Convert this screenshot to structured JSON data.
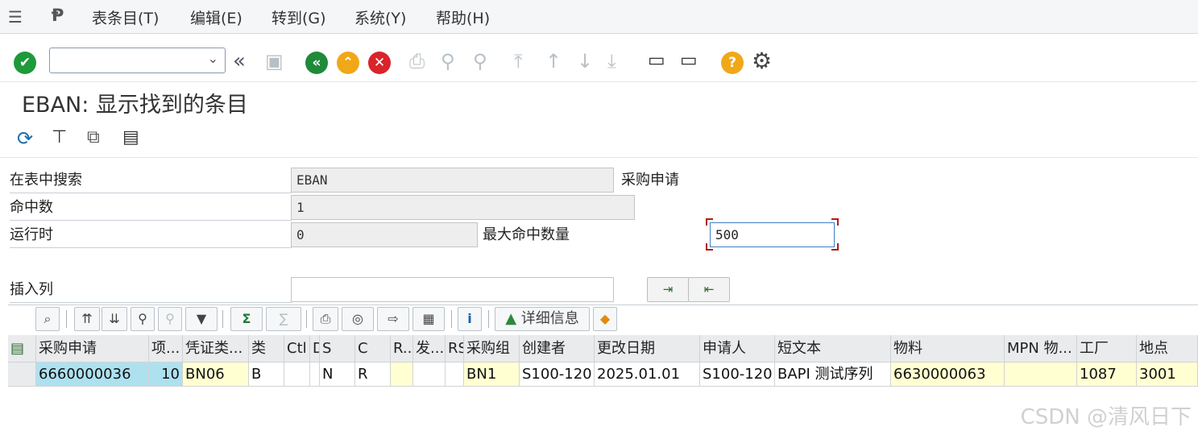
{
  "menu": {
    "items": [
      "表条目(T)",
      "编辑(E)",
      "转到(G)",
      "系统(Y)",
      "帮助(H)"
    ]
  },
  "toolbar": {
    "command_value": ""
  },
  "screen": {
    "title": "EBAN: 显示找到的条目"
  },
  "search": {
    "table_label": "在表中搜索",
    "table_value": "EBAN",
    "table_desc": "采购申请",
    "hits_label": "命中数",
    "hits_value": "1",
    "runtime_label": "运行时",
    "runtime_value": "0",
    "max_hits_label": "最大命中数量",
    "max_hits_value": "500",
    "insert_col_label": "插入列",
    "insert_col_value": ""
  },
  "grid_toolbar": {
    "sum_symbol": "Σ",
    "info_symbol": "i",
    "details_label": "详细信息"
  },
  "table": {
    "columns": [
      "采购申请",
      "项...",
      "凭证类...",
      "类",
      "Ctl",
      "D",
      "S",
      "C",
      "R...",
      "发...",
      "RS",
      "采购组",
      "创建者",
      "更改日期",
      "申请人",
      "短文本",
      "物料",
      "MPN 物...",
      "工厂",
      "地点"
    ],
    "rows": [
      [
        "6660000036",
        "10",
        "BN06",
        "B",
        "",
        "",
        "N",
        "R",
        "",
        "",
        "",
        "BN1",
        "S100-120",
        "2025.01.01",
        "S100-120",
        "BAPI 测试序列",
        "6630000063",
        "",
        "1087",
        "3001"
      ]
    ]
  },
  "watermark": "CSDN @清风日下",
  "colors": {
    "accept_green": "#1e9a3a",
    "back_green": "#1e8a3a",
    "exit_orange": "#f0a818",
    "cancel_red": "#d9242a",
    "help_orange": "#f0a818",
    "key_cell": "#aee1f0",
    "highlight_cell": "#ffffd2"
  }
}
